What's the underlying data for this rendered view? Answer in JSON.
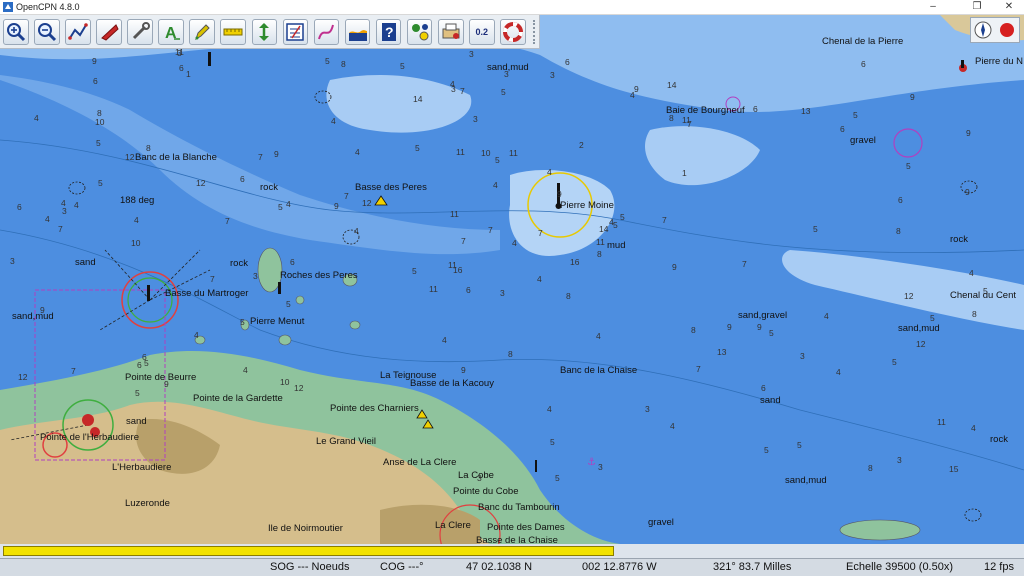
{
  "window": {
    "title": "OpenCPN 4.8.0",
    "minimize": "–",
    "restore": "❐",
    "close": "✕"
  },
  "toolbar": {
    "items": [
      {
        "name": "zoom-in-icon"
      },
      {
        "name": "zoom-out-icon"
      },
      {
        "name": "route-icon"
      },
      {
        "name": "ais-boat-icon"
      },
      {
        "name": "settings-wrench-icon"
      },
      {
        "name": "text-icon"
      },
      {
        "name": "pencil-icon"
      },
      {
        "name": "ruler-icon"
      },
      {
        "name": "vertical-arrow-icon"
      },
      {
        "name": "route-manager-icon"
      },
      {
        "name": "track-icon"
      },
      {
        "name": "tide-icon"
      },
      {
        "name": "help-icon"
      },
      {
        "name": "marks-icon"
      },
      {
        "name": "print-icon"
      },
      {
        "name": "zoom-level-icon"
      },
      {
        "name": "lifebuoy-icon"
      }
    ],
    "zoom_badge": "0.2"
  },
  "chart": {
    "labels": [
      {
        "text": "Chenal de la Pierre"
      },
      {
        "text": "Pierre du N"
      },
      {
        "text": "Baie de Bourgneuf"
      },
      {
        "text": "Banc de la Blanche"
      },
      {
        "text": "Basse des Peres"
      },
      {
        "text": "Pierre Moine"
      },
      {
        "text": "Roches des Peres"
      },
      {
        "text": "Basse du Martroger"
      },
      {
        "text": "Pierre Menut"
      },
      {
        "text": "Chenal du Cent"
      },
      {
        "text": "La Teignouse"
      },
      {
        "text": "Basse de la Kacouy"
      },
      {
        "text": "Banc de la Chaise"
      },
      {
        "text": "Pointe de Beurre"
      },
      {
        "text": "Pointe de la Gardette"
      },
      {
        "text": "Pointe des Charniers"
      },
      {
        "text": "Le Grand Vieil"
      },
      {
        "text": "Anse de La Clere"
      },
      {
        "text": "La Cobe"
      },
      {
        "text": "Pointe du Cobe"
      },
      {
        "text": "Banc du Tambourin"
      },
      {
        "text": "La Clere"
      },
      {
        "text": "Pointe des Dames"
      },
      {
        "text": "Basse de la Chaise"
      },
      {
        "text": "L'Herbaudiere"
      },
      {
        "text": "Luzeronde"
      },
      {
        "text": "Ile de Noirmoutier"
      },
      {
        "text": "Pointe de l'Herbaudiere"
      },
      {
        "text": "188 deg"
      },
      {
        "text": "sand,mud"
      },
      {
        "text": "gravel"
      },
      {
        "text": "rock"
      },
      {
        "text": "mud"
      },
      {
        "text": "sand"
      },
      {
        "text": "sand,gravel"
      },
      {
        "text": "sand,mud"
      },
      {
        "text": "sand,mud"
      },
      {
        "text": "sand,mud"
      },
      {
        "text": "rock"
      },
      {
        "text": "rock"
      },
      {
        "text": "rock"
      },
      {
        "text": "sand"
      },
      {
        "text": "sand"
      },
      {
        "text": "gravel"
      }
    ],
    "soundings": [
      "3",
      "12",
      "16",
      "14",
      "12",
      "14",
      "11",
      "11",
      "16",
      "1",
      "15",
      "10",
      "9",
      "11",
      "1",
      "11",
      "9",
      "9",
      "12",
      "10",
      "5",
      "5",
      "8",
      "7",
      "7",
      "8",
      "9",
      "11",
      "7",
      "9",
      "6",
      "10",
      "8",
      "11",
      "9",
      "6",
      "9",
      "7",
      "7",
      "6",
      "11",
      "8",
      "5",
      "5",
      "4",
      "13",
      "4",
      "6",
      "9",
      "4",
      "5",
      "3",
      "6",
      "4",
      "6",
      "13",
      "11",
      "9",
      "14",
      "7",
      "12",
      "9",
      "9",
      "5",
      "6",
      "12",
      "9",
      "11",
      "5",
      "7",
      "9",
      "12",
      "8",
      "8",
      "5",
      "5",
      "3",
      "4",
      "5",
      "7",
      "6",
      "4",
      "5",
      "3",
      "3",
      "8",
      "7",
      "7",
      "5",
      "4",
      "4",
      "4",
      "4",
      "4",
      "6",
      "4",
      "12",
      "10",
      "5",
      "5",
      "8",
      "7",
      "6",
      "9",
      "5",
      "5",
      "6",
      "6",
      "4",
      "4",
      "7",
      "5",
      "3",
      "5",
      "5",
      "5",
      "3",
      "4",
      "4",
      "5",
      "3",
      "5",
      "6",
      "8",
      "7",
      "8",
      "4",
      "4",
      "4",
      "5",
      "8",
      "5",
      "3",
      "6",
      "7",
      "4",
      "4",
      "3",
      "3",
      "4",
      "3",
      "2",
      "4",
      "5",
      "3",
      "3",
      "4",
      "5",
      "4",
      "4",
      "3"
    ]
  },
  "status": {
    "sog": "SOG --- Noeuds",
    "cog": "COG ---°",
    "lat": "47 02.1038 N",
    "lon": "002 12.8776 W",
    "bearing_dist": "321°  83.7 Milles",
    "scale": "Echelle 39500 (0.50x)",
    "fps": "12 fps"
  },
  "progress": 0.6
}
